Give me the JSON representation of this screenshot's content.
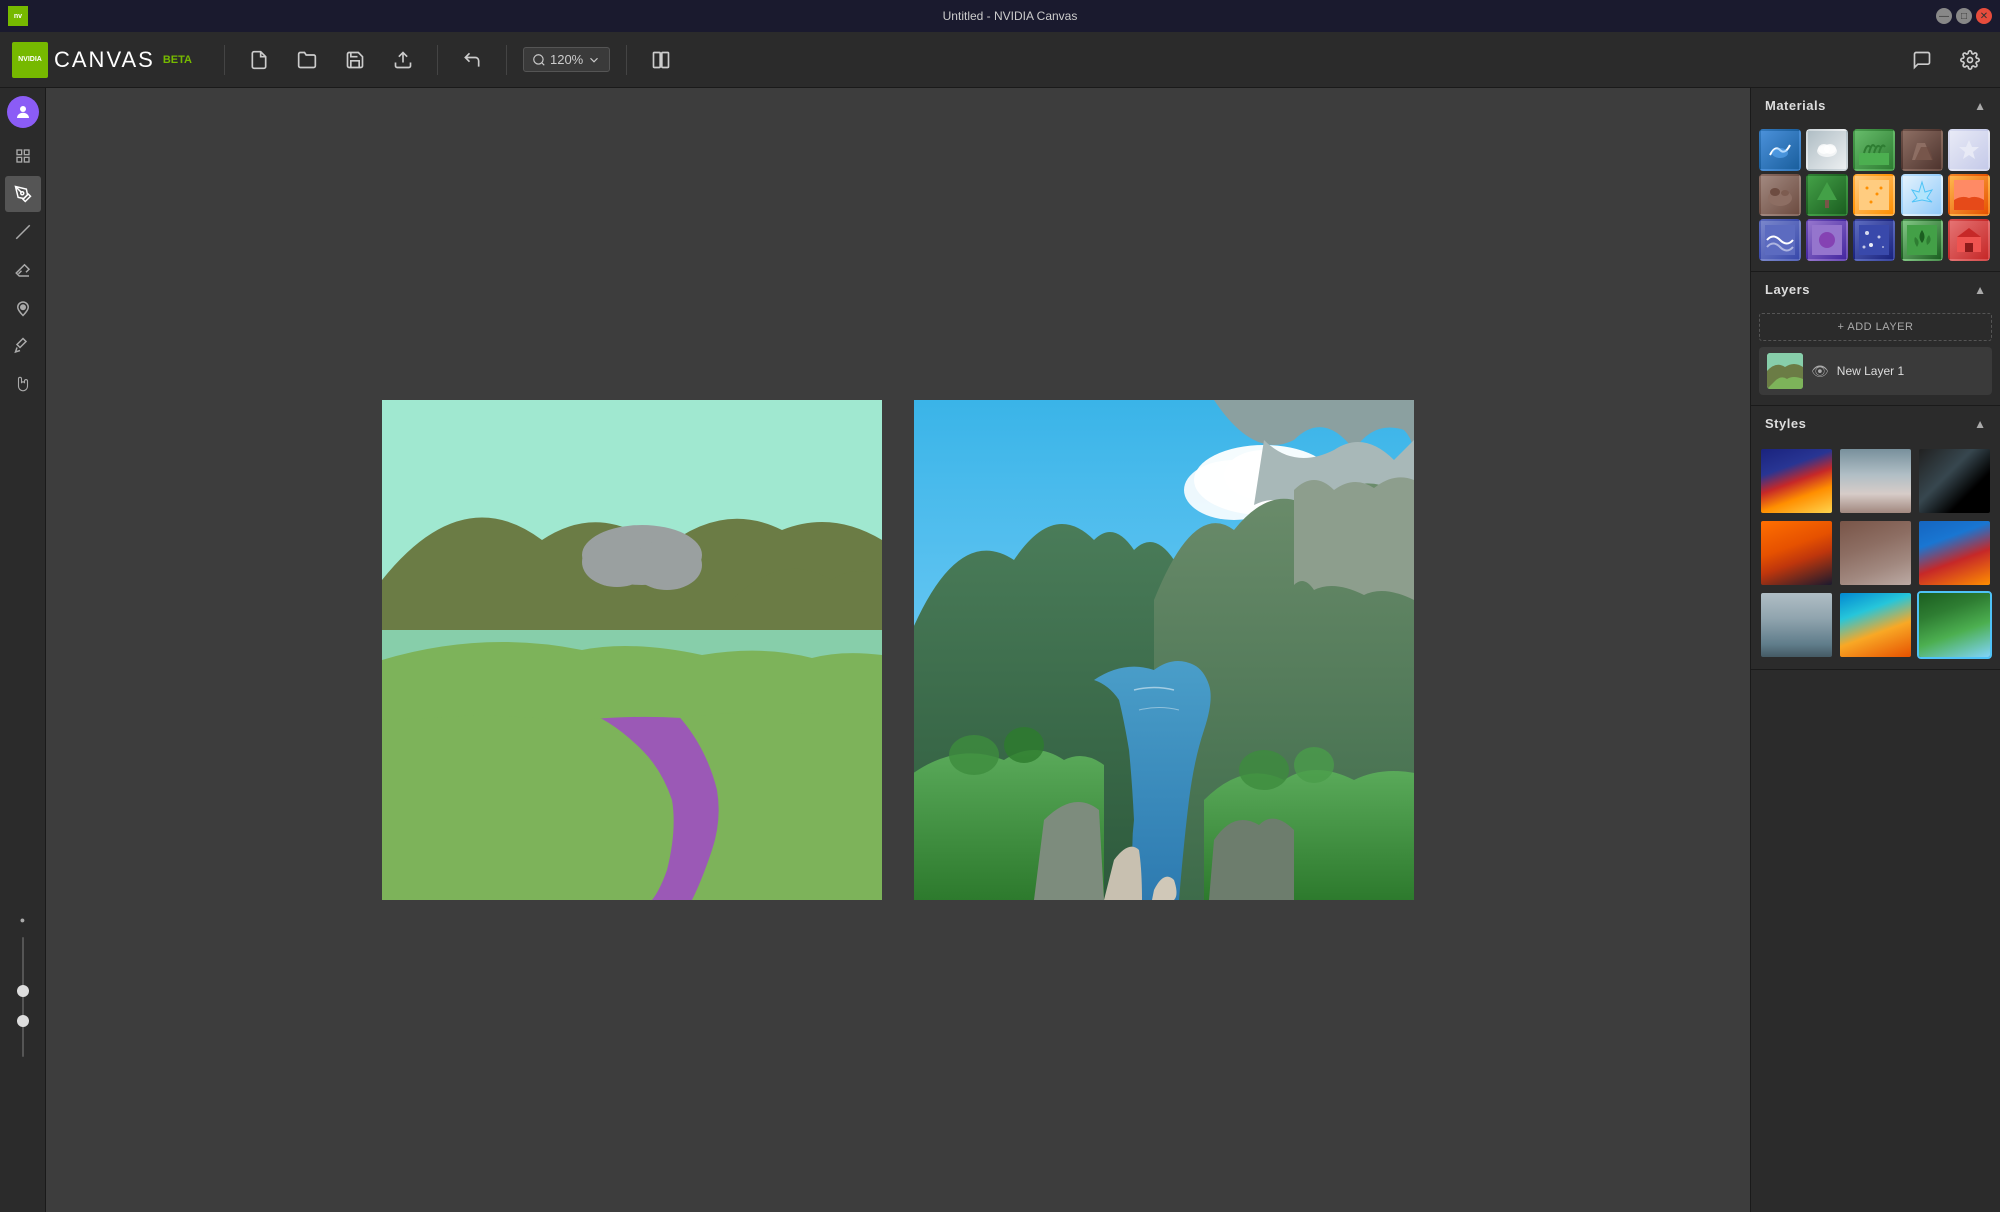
{
  "titlebar": {
    "title": "Untitled - NVIDIA Canvas",
    "controls": {
      "minimize": "—",
      "maximize": "□",
      "close": "✕"
    }
  },
  "toolbar": {
    "logo_text": "CANVAS",
    "logo_beta": "BETA",
    "nvidia_label": "NVIDIA",
    "new_label": "New",
    "open_label": "Open",
    "save_label": "Save",
    "export_label": "Export",
    "undo_label": "Undo",
    "zoom_value": "120%",
    "toggle_label": "Toggle",
    "chat_label": "Chat",
    "settings_label": "Settings"
  },
  "left_toolbar": {
    "tools": [
      {
        "name": "grid",
        "icon": "⊞"
      },
      {
        "name": "brush",
        "icon": "✏"
      },
      {
        "name": "line",
        "icon": "╱"
      },
      {
        "name": "eraser",
        "icon": "◻"
      },
      {
        "name": "fill",
        "icon": "▼"
      },
      {
        "name": "picker",
        "icon": "✦"
      },
      {
        "name": "pan",
        "icon": "✋"
      },
      {
        "name": "circle",
        "icon": "○"
      }
    ]
  },
  "right_panel": {
    "materials": {
      "title": "Materials",
      "items": [
        {
          "name": "water",
          "class": "mat-water",
          "label": "Water"
        },
        {
          "name": "cloud",
          "class": "mat-cloud",
          "label": "Cloud"
        },
        {
          "name": "grass",
          "class": "mat-grass",
          "label": "Grass"
        },
        {
          "name": "rock",
          "class": "mat-rock",
          "label": "Rock"
        },
        {
          "name": "snow",
          "class": "mat-snow",
          "label": "Snow"
        },
        {
          "name": "dirt",
          "class": "mat-dirt",
          "label": "Dirt"
        },
        {
          "name": "tree",
          "class": "mat-tree",
          "label": "Tree"
        },
        {
          "name": "sand",
          "class": "mat-sand",
          "label": "Sand"
        },
        {
          "name": "ice",
          "class": "mat-ice",
          "label": "Ice"
        },
        {
          "name": "desert",
          "class": "mat-desert",
          "label": "Desert"
        },
        {
          "name": "wave",
          "class": "mat-wave",
          "label": "Wave"
        },
        {
          "name": "purple",
          "class": "mat-purple",
          "label": "Purple"
        },
        {
          "name": "sparkle",
          "class": "mat-sparkle",
          "label": "Sparkle"
        },
        {
          "name": "barn",
          "class": "mat-barn",
          "label": "Barn"
        },
        {
          "name": "green2",
          "class": "mat-green2",
          "label": "Green2"
        }
      ]
    },
    "layers": {
      "title": "Layers",
      "add_label": "+ ADD LAYER",
      "items": [
        {
          "name": "New Layer 1",
          "visible": true,
          "id": "layer1"
        }
      ]
    },
    "styles": {
      "title": "Styles",
      "items": [
        {
          "name": "mountains-blue",
          "class": "style-mountains-blue"
        },
        {
          "name": "cloud-dramatic",
          "class": "style-cloud-dramatic"
        },
        {
          "name": "dark-arch",
          "class": "style-dark-arch"
        },
        {
          "name": "orange-mtn",
          "class": "style-orange-mtn"
        },
        {
          "name": "rocky",
          "class": "style-rocky"
        },
        {
          "name": "sunset-sea",
          "class": "style-sunset-sea"
        },
        {
          "name": "misty",
          "class": "style-misty"
        },
        {
          "name": "tropical",
          "class": "style-tropical"
        },
        {
          "name": "alpine",
          "class": "style-alpine",
          "selected": true
        }
      ]
    }
  }
}
